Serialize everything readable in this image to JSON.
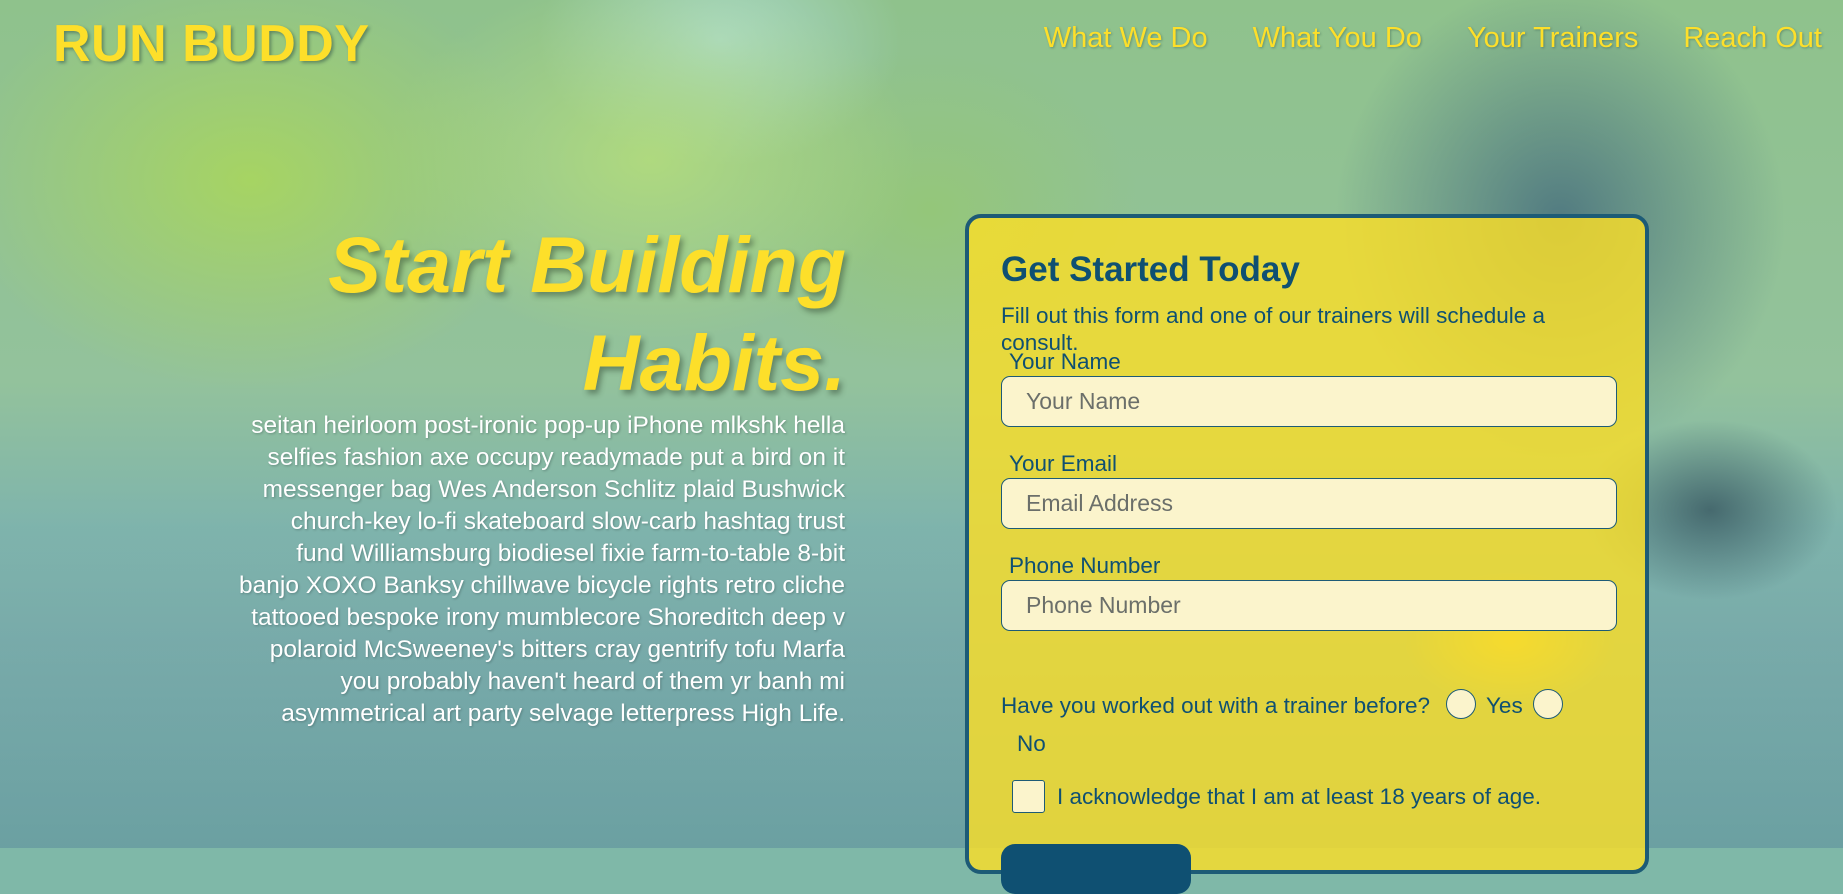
{
  "brand": {
    "name": "RUN BUDDY"
  },
  "nav": {
    "items": [
      {
        "label": "What We Do"
      },
      {
        "label": "What You Do"
      },
      {
        "label": "Your Trainers"
      },
      {
        "label": "Reach Out"
      }
    ]
  },
  "hero": {
    "title_line1": "Start Building",
    "title_line2": "Habits.",
    "copy": "seitan heirloom post-ironic pop-up iPhone mlkshk hella selfies fashion axe occupy readymade put a bird on it messenger bag Wes Anderson Schlitz plaid Bushwick church-key lo-fi skateboard slow-carb hashtag trust fund Williamsburg biodiesel fixie farm-to-table 8-bit banjo XOXO Banksy chillwave bicycle rights retro cliche tattooed bespoke irony mumblecore Shoreditch deep v polaroid McSweeney's bitters cray gentrify tofu Marfa you probably haven't heard of them yr banh mi asymmetrical art party selvage letterpress High Life."
  },
  "form": {
    "title": "Get Started Today",
    "subtitle": "Fill out this form and one of our trainers will schedule a consult.",
    "name_label": "Your Name",
    "name_placeholder": "Your Name",
    "email_label": "Your Email",
    "email_placeholder": "Email Address",
    "phone_label": "Phone Number",
    "phone_placeholder": "Phone Number",
    "question": "Have you worked out with a trainer before?",
    "option_yes": "Yes",
    "option_no": "No",
    "acknowledge": "I acknowledge that I am at least 18 years of age."
  },
  "colors": {
    "accent_yellow": "#fddf2a",
    "brand_navy": "#0f5072",
    "card_bg": "#fade28",
    "input_bg": "#fbf4cc"
  }
}
